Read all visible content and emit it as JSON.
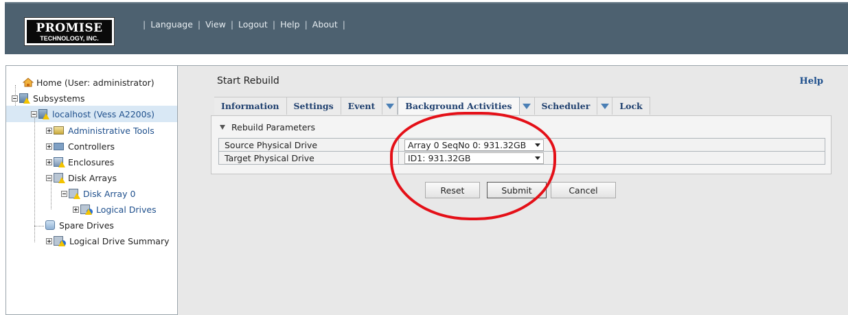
{
  "header": {
    "logo_main": "PROMISE",
    "logo_sub": "TECHNOLOGY, INC.",
    "nav": [
      "Language",
      "View",
      "Logout",
      "Help",
      "About"
    ]
  },
  "tree": {
    "home": "Home (User: administrator)",
    "subsystems": "Subsystems",
    "localhost": "localhost (Vess A2200s)",
    "admin_tools": "Administrative Tools",
    "controllers": "Controllers",
    "enclosures": "Enclosures",
    "disk_arrays": "Disk Arrays",
    "disk_array_0": "Disk Array 0",
    "logical_drives": "Logical Drives",
    "spare_drives": "Spare Drives",
    "logical_drive_summary": "Logical Drive Summary"
  },
  "content": {
    "title": "Start Rebuild",
    "help": "Help",
    "tabs": [
      "Information",
      "Settings",
      "Event",
      "Background Activities",
      "Scheduler",
      "Lock"
    ],
    "section_title": "Rebuild Parameters",
    "params": [
      {
        "label": "Source Physical Drive",
        "value": "Array 0 SeqNo 0: 931.32GB"
      },
      {
        "label": "Target Physical Drive",
        "value": "ID1: 931.32GB"
      }
    ],
    "buttons": {
      "reset": "Reset",
      "submit": "Submit",
      "cancel": "Cancel"
    }
  },
  "colors": {
    "header_bg": "#4d6170",
    "selected_row": "#d9e8f5",
    "tab_text": "#1e3f6e",
    "link_blue": "#1e4f8c",
    "annotation_red": "#e41018",
    "content_bg": "#e8e8e8"
  }
}
